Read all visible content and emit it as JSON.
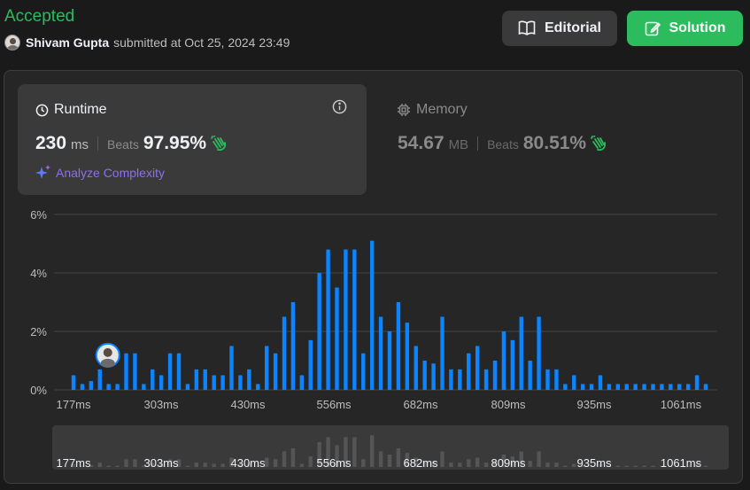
{
  "header": {
    "status": "Accepted",
    "submitter_name": "Shivam Gupta",
    "submitted_text": "submitted at Oct 25, 2024 23:49"
  },
  "buttons": {
    "editorial_label": "Editorial",
    "solution_label": "Solution"
  },
  "runtime": {
    "title": "Runtime",
    "value": "230",
    "unit": "ms",
    "beats_label": "Beats",
    "beats_pct": "97.95%",
    "analyze_label": "Analyze Complexity"
  },
  "memory": {
    "title": "Memory",
    "value": "54.67",
    "unit": "MB",
    "beats_label": "Beats",
    "beats_pct": "80.51%"
  },
  "colors": {
    "accepted": "#2cbb5d",
    "bar": "#0a84ff",
    "clap": "#2cbb5d",
    "analyze": "#8c6ff0"
  },
  "chart_data": {
    "type": "bar",
    "y_ticks": [
      "0%",
      "2%",
      "4%",
      "6%"
    ],
    "ylim": [
      0,
      6
    ],
    "x_tick_labels": [
      "177ms",
      "303ms",
      "430ms",
      "556ms",
      "682ms",
      "809ms",
      "935ms",
      "1061ms"
    ],
    "values": [
      0.5,
      0.2,
      0.3,
      0.7,
      0.2,
      0.2,
      1.25,
      1.25,
      0.2,
      0.7,
      0.5,
      1.25,
      1.25,
      0.2,
      0.7,
      0.7,
      0.5,
      0.5,
      1.5,
      0.5,
      0.7,
      0.2,
      1.5,
      1.25,
      2.5,
      3.0,
      0.5,
      1.7,
      4.0,
      4.8,
      3.5,
      4.8,
      4.8,
      1.25,
      5.1,
      2.5,
      2.0,
      3.0,
      2.3,
      1.5,
      1.0,
      0.9,
      2.5,
      0.7,
      0.7,
      1.25,
      1.5,
      0.7,
      1.0,
      2.0,
      1.7,
      2.5,
      1.0,
      2.5,
      0.7,
      0.7,
      0.2,
      0.5,
      0.2,
      0.2,
      0.5,
      0.2,
      0.2,
      0.2,
      0.2,
      0.2,
      0.2,
      0.2,
      0.2,
      0.2,
      0.2,
      0.5,
      0.2
    ],
    "user_bar_index": 3,
    "grid": true
  }
}
